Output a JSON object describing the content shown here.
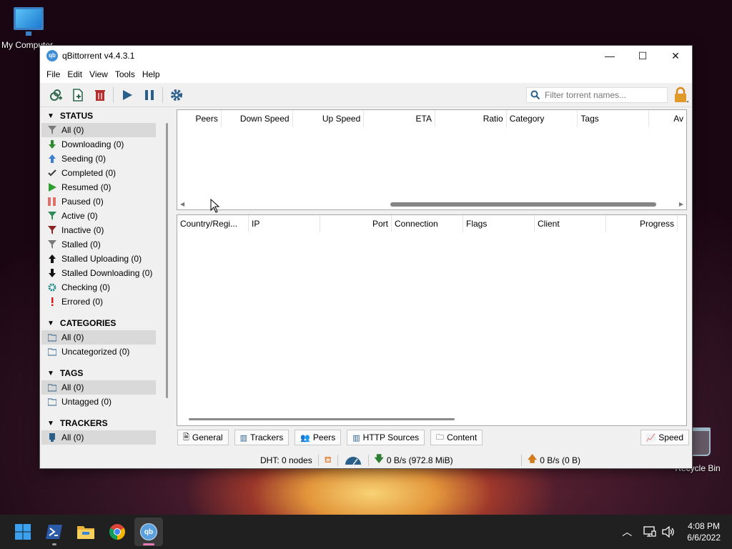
{
  "desktop": {
    "icons": [
      {
        "label": "My Computer"
      },
      {
        "label": "Recycle Bin"
      }
    ]
  },
  "window": {
    "title": "qBittorrent v4.4.3.1",
    "logo_text": "qb",
    "controls": {
      "minimize": "—",
      "maximize": "☐",
      "close": "✕"
    }
  },
  "menu": [
    "File",
    "Edit",
    "View",
    "Tools",
    "Help"
  ],
  "toolbar": {
    "buttons": [
      "add-torrent-link",
      "add-torrent-file",
      "delete",
      "resume",
      "pause",
      "options"
    ],
    "search_placeholder": "Filter torrent names..."
  },
  "sidebar": {
    "status": {
      "title": "STATUS",
      "items": [
        {
          "label": "All (0)",
          "icon": "filter-icon",
          "color": "#7a7a7a",
          "selected": true
        },
        {
          "label": "Downloading (0)",
          "icon": "arrow-down-icon",
          "color": "#2e8b2e"
        },
        {
          "label": "Seeding (0)",
          "icon": "arrow-up-icon",
          "color": "#3c7fd1"
        },
        {
          "label": "Completed (0)",
          "icon": "check-icon",
          "color": "#444444"
        },
        {
          "label": "Resumed (0)",
          "icon": "play-icon",
          "color": "#2e9e2e"
        },
        {
          "label": "Paused (0)",
          "icon": "pause-icon",
          "color": "#e0706a"
        },
        {
          "label": "Active (0)",
          "icon": "filter-icon",
          "color": "#2e8b57"
        },
        {
          "label": "Inactive (0)",
          "icon": "filter-icon",
          "color": "#8b2323"
        },
        {
          "label": "Stalled (0)",
          "icon": "filter-icon",
          "color": "#7a7a7a"
        },
        {
          "label": "Stalled Uploading (0)",
          "icon": "arrow-up-icon",
          "color": "#111111"
        },
        {
          "label": "Stalled Downloading (0)",
          "icon": "arrow-down-icon",
          "color": "#111111"
        },
        {
          "label": "Checking (0)",
          "icon": "gear-icon",
          "color": "#1a8a8a"
        },
        {
          "label": "Errored (0)",
          "icon": "exclamation-icon",
          "color": "#d42020"
        }
      ]
    },
    "categories": {
      "title": "CATEGORIES",
      "items": [
        {
          "label": "All (0)",
          "selected": true
        },
        {
          "label": "Uncategorized (0)"
        }
      ]
    },
    "tags": {
      "title": "TAGS",
      "items": [
        {
          "label": "All (0)",
          "selected": true
        },
        {
          "label": "Untagged (0)"
        }
      ]
    },
    "trackers": {
      "title": "TRACKERS",
      "items": [
        {
          "label": "All (0)",
          "selected": true
        }
      ]
    }
  },
  "torrent_list": {
    "columns": [
      "Peers",
      "Down Speed",
      "Up Speed",
      "ETA",
      "Ratio",
      "Category",
      "Tags",
      "Av"
    ]
  },
  "peers_list": {
    "columns": [
      "Country/Regi...",
      "IP",
      "Port",
      "Connection",
      "Flags",
      "Client",
      "Progress"
    ]
  },
  "tabs": [
    "General",
    "Trackers",
    "Peers",
    "HTTP Sources",
    "Content",
    "Speed"
  ],
  "statusbar": {
    "dht": "DHT: 0 nodes",
    "download": "0 B/s (972.8 MiB)",
    "upload": "0 B/s (0 B)"
  },
  "taskbar": {
    "time": "4:08 PM",
    "date": "6/6/2022"
  }
}
